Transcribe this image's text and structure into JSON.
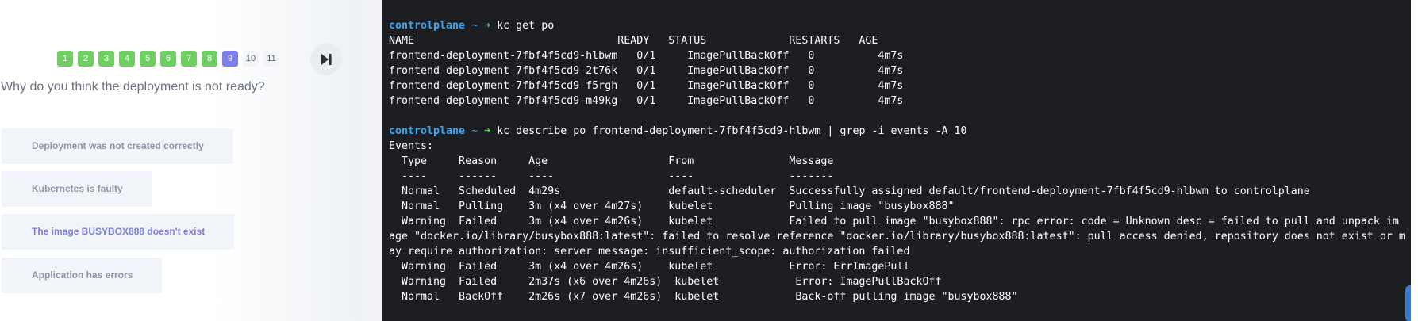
{
  "quiz": {
    "questions": [
      {
        "label": "1",
        "state": "done"
      },
      {
        "label": "2",
        "state": "done"
      },
      {
        "label": "3",
        "state": "done"
      },
      {
        "label": "4",
        "state": "done"
      },
      {
        "label": "5",
        "state": "done"
      },
      {
        "label": "6",
        "state": "done"
      },
      {
        "label": "7",
        "state": "done"
      },
      {
        "label": "8",
        "state": "done"
      },
      {
        "label": "9",
        "state": "current"
      },
      {
        "label": "10",
        "state": "todo"
      },
      {
        "label": "11",
        "state": "todo"
      }
    ],
    "skip_icon": "skip-forward-icon",
    "question_text": "Why do you think the deployment is not ready?",
    "answers": [
      "Deployment was not created correctly",
      "Kubernetes is faulty",
      "The image BUSYBOX888 doesn't exist",
      "Application has errors"
    ],
    "colors": {
      "done": "#6fcf63",
      "current": "#7d7ff0",
      "answer_text": "#8e97a8",
      "answer_highlight": "#7e80d6"
    }
  },
  "terminal": {
    "prompt": {
      "host": "controlplane",
      "tilde": "~",
      "arrow": "➜"
    },
    "command1": "kc get po",
    "table_header": "NAME                                READY   STATUS             RESTARTS   AGE",
    "table_rows": [
      "frontend-deployment-7fbf4f5cd9-hlbwm   0/1     ImagePullBackOff   0          4m7s",
      "frontend-deployment-7fbf4f5cd9-2t76k   0/1     ImagePullBackOff   0          4m7s",
      "frontend-deployment-7fbf4f5cd9-f5rgh   0/1     ImagePullBackOff   0          4m7s",
      "frontend-deployment-7fbf4f5cd9-m49kg   0/1     ImagePullBackOff   0          4m7s"
    ],
    "command2": "kc describe po frontend-deployment-7fbf4f5cd9-hlbwm | grep -i events -A 10",
    "events_lines": [
      "Events:",
      "  Type     Reason     Age                   From               Message",
      "  ----     ------     ----                  ----               -------",
      "  Normal   Scheduled  4m29s                 default-scheduler  Successfully assigned default/frontend-deployment-7fbf4f5cd9-hlbwm to controlplane",
      "  Normal   Pulling    3m (x4 over 4m27s)    kubelet            Pulling image \"busybox888\"",
      "  Warning  Failed     3m (x4 over 4m26s)    kubelet            Failed to pull image \"busybox888\": rpc error: code = Unknown desc = failed to pull and unpack im",
      "age \"docker.io/library/busybox888:latest\": failed to resolve reference \"docker.io/library/busybox888:latest\": pull access denied, repository does not exist or m",
      "ay require authorization: server message: insufficient_scope: authorization failed",
      "  Warning  Failed     3m (x4 over 4m26s)    kubelet            Error: ErrImagePull",
      "  Warning  Failed     2m37s (x6 over 4m26s)  kubelet            Error: ImagePullBackOff",
      "  Normal   BackOff    2m26s (x7 over 4m26s)  kubelet            Back-off pulling image \"busybox888\""
    ]
  }
}
